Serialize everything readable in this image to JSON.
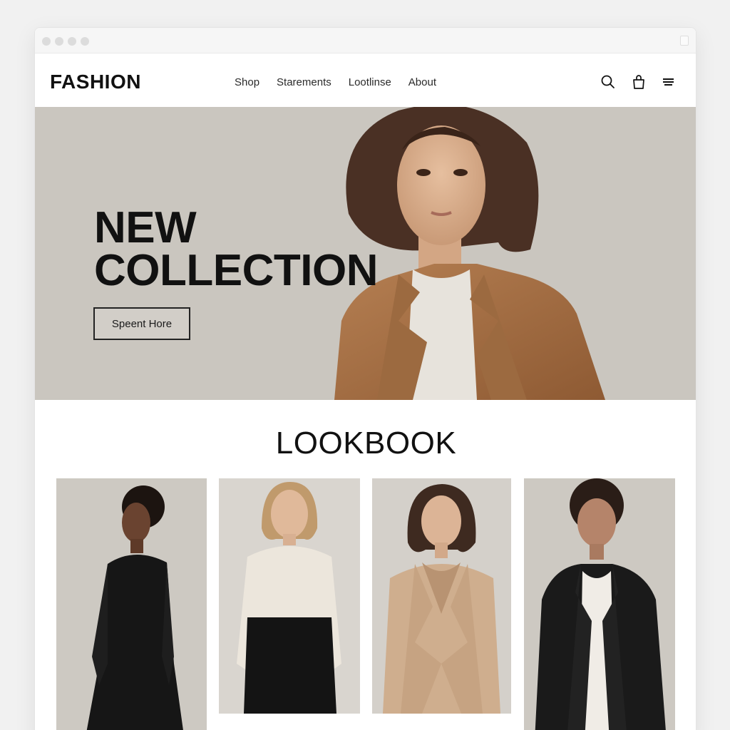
{
  "brand": "FASHION",
  "nav": {
    "items": [
      "Shop",
      "Starements",
      "Lootlinse",
      "About"
    ]
  },
  "icons": [
    "search-icon",
    "bag-icon",
    "menu-icon"
  ],
  "hero": {
    "title_line1": "NEW",
    "title_line2": "COLLECTION",
    "button_label": "Speent Hore"
  },
  "lookbook": {
    "title": "LOOKBOOK",
    "cards": [
      "lookbook-card-1",
      "lookbook-card-2",
      "lookbook-card-3",
      "lookbook-card-4"
    ]
  },
  "colors": {
    "hero_bg": "#cac6bf",
    "coat": "#a9744a",
    "text": "#111111"
  }
}
